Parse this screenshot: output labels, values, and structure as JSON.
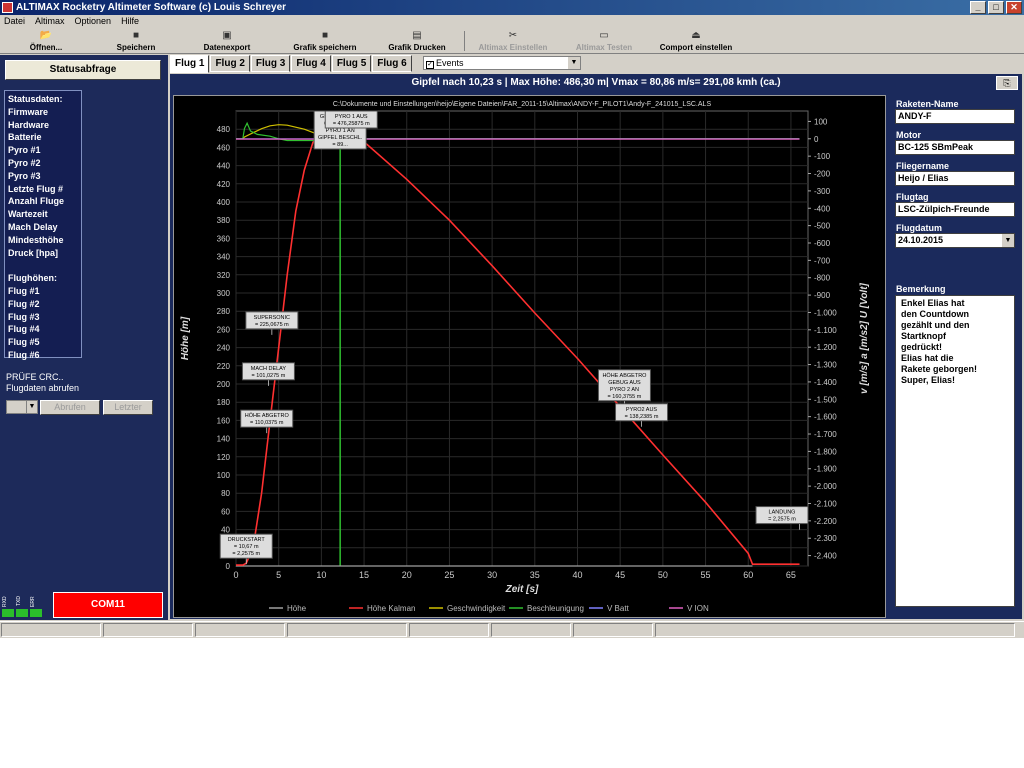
{
  "window": {
    "title": "ALTIMAX Rocketry Altimeter Software     (c) Louis Schreyer"
  },
  "menu": [
    "Datei",
    "Altimax",
    "Optionen",
    "Hilfe"
  ],
  "toolbar": {
    "open": "Öffnen...",
    "save": "Speichern",
    "export": "Datenexport",
    "save_graph": "Grafik speichern",
    "print_graph": "Grafik Drucken",
    "altimax_settings": "Altimax Einstellen",
    "altimax_test": "Altimax Testen",
    "comport": "Comport einstellen"
  },
  "left": {
    "status_button": "Statusabfrage",
    "status_items": [
      "Statusdaten:",
      "Firmware",
      "Hardware",
      "Batterie",
      "Pyro #1",
      "Pyro #2",
      "Pyro #3",
      "Letzte Flug #",
      "Anzahl Fluge",
      "Wartezeit",
      "Mach Delay",
      "Mindesthöhe",
      "Druck [hpa]",
      "",
      "Flughöhen:",
      "Flug #1",
      "Flug #2",
      "Flug #3",
      "Flug #4",
      "Flug #5",
      "Flug #6"
    ],
    "crc": "PRÜFE CRC..",
    "flugdaten": "Flugdaten abrufen",
    "fetch": "Abrufen",
    "last": "Letzter",
    "leds": [
      "RXD",
      "TXD",
      "ERR"
    ],
    "com": "COM11"
  },
  "tabs": [
    "Flug 1",
    "Flug 2",
    "Flug 3",
    "Flug 4",
    "Flug 5",
    "Flug 6"
  ],
  "events_select": "Events",
  "info_bar": "Gipfel nach 10,23 s | Max Höhe: 486,30 m| Vmax = 80,86 m/s= 291,08 kmh (ca.)",
  "chart_data": {
    "type": "line",
    "path_text": "C:\\Dokumente und Einstellungen\\heijo\\Eigene Dateien\\FAR_2011-15\\Altimax\\ANDY-F_PILOT1\\Andy-F_241015_LSC.ALS",
    "xlabel": "Zeit [s]",
    "ylabel": "Höhe [m]",
    "y2label": "v [m/s]  a [m/s2]  U [Volt]",
    "xlim": [
      0,
      67
    ],
    "ylim": [
      0,
      500
    ],
    "y2lim": [
      -2460,
      160
    ],
    "x_ticks": [
      0,
      5,
      10,
      15,
      20,
      25,
      30,
      35,
      40,
      45,
      50,
      55,
      60,
      65
    ],
    "y_ticks": [
      0,
      20,
      40,
      60,
      80,
      100,
      120,
      140,
      160,
      180,
      200,
      220,
      240,
      260,
      280,
      300,
      320,
      340,
      360,
      380,
      400,
      420,
      440,
      460,
      480
    ],
    "y2_ticks": [
      100,
      0,
      -100,
      -200,
      -300,
      -400,
      -500,
      -600,
      -700,
      -800,
      -900,
      -1000,
      -1100,
      -1200,
      -1300,
      -1400,
      -1500,
      -1600,
      -1700,
      -1800,
      -1900,
      -2000,
      -2100,
      -2200,
      -2300,
      -2400
    ],
    "y2_tick_labels": [
      "100",
      "0",
      "-100",
      "-200",
      "-300",
      "-400",
      "-500",
      "-600",
      "-700",
      "-800",
      "-900",
      "-1.000",
      "-1.100",
      "-1.200",
      "-1.300",
      "-1.400",
      "-1.500",
      "-1.600",
      "-1.700",
      "-1.800",
      "-1.900",
      "-2.000",
      "-2.100",
      "-2.200",
      "-2.300",
      "-2.400"
    ],
    "grid": true,
    "legend_position": "bottom",
    "series": [
      {
        "name": "Höhe",
        "color": "#a0a0a0",
        "axis": "left",
        "x": [
          0,
          60.5
        ],
        "y": [
          0,
          0
        ]
      },
      {
        "name": "Höhe Kalman",
        "color": "#ff3030",
        "axis": "left",
        "x": [
          0,
          0.8,
          1.2,
          2,
          3,
          4,
          5,
          6,
          7,
          8,
          9,
          10,
          10.23,
          11,
          12,
          13,
          14,
          15,
          20,
          25,
          30,
          35,
          40,
          45,
          50,
          55,
          60,
          60.5,
          62,
          66
        ],
        "y": [
          1,
          1,
          3,
          20,
          80,
          160,
          240,
          320,
          390,
          435,
          465,
          482,
          486,
          490,
          489,
          482,
          474,
          466,
          425,
          380,
          330,
          278,
          228,
          175,
          122,
          70,
          14,
          2,
          2,
          2
        ]
      },
      {
        "name": "Geschwindigkeit",
        "color": "#d0c000",
        "axis": "right",
        "x": [
          0,
          0.8,
          1,
          2,
          3,
          4,
          5,
          6,
          8,
          10,
          10.23,
          12,
          13,
          14,
          20,
          40,
          60,
          66
        ],
        "y": [
          0,
          0,
          10,
          35,
          58,
          75,
          81,
          78,
          55,
          18,
          15,
          2,
          0,
          0,
          0,
          0,
          0,
          0
        ]
      },
      {
        "name": "Beschleunigung",
        "color": "#30c030",
        "axis": "right",
        "x": [
          0,
          0.8,
          1,
          1.3,
          1.7,
          2.5,
          4,
          5,
          6,
          8,
          10,
          12,
          14,
          20,
          40,
          60,
          66
        ],
        "y": [
          0,
          0,
          60,
          90,
          45,
          25,
          15,
          0,
          -10,
          -10,
          -10,
          -5,
          0,
          0,
          0,
          0,
          0
        ]
      },
      {
        "name": "V Batt",
        "color": "#8080ff",
        "axis": "right",
        "x": [
          0,
          66
        ],
        "y": [
          0,
          0
        ]
      },
      {
        "name": "V ION",
        "color": "#e060c0",
        "axis": "right",
        "x": [
          0,
          66
        ],
        "y": [
          -2,
          -2
        ]
      }
    ],
    "event_lines": [
      {
        "x": 12.2,
        "color": "#30c030"
      }
    ],
    "annotations": [
      {
        "x": 1.2,
        "y": 2,
        "lines": [
          "DRUCKSTART",
          "= 10,67 m",
          "= 2,2575 m"
        ]
      },
      {
        "x": 4.2,
        "y": 254,
        "lines": [
          "SUPERSONIC",
          "= 225,0675 m"
        ]
      },
      {
        "x": 3.8,
        "y": 198,
        "lines": [
          "MACH DELAY",
          "= 101,0275 m"
        ]
      },
      {
        "x": 3.6,
        "y": 146,
        "lines": [
          "HÖHE ABGETRO",
          "= 110,0375 m"
        ]
      },
      {
        "x": 12.2,
        "y": 486,
        "lines": [
          "GIPFEL DRUCK",
          "GEBUG AUS",
          "PYRO 1 AN",
          "GIPFEL BESCHL.",
          "= 89..."
        ]
      },
      {
        "x": 13.5,
        "y": 480,
        "lines": [
          "PYRO 1 AUS",
          "= 476,25875 m"
        ]
      },
      {
        "x": 45.5,
        "y": 175,
        "lines": [
          "HÖHE ABGETRO",
          "GEBUG AUS",
          "PYRO 2 AN",
          "= 160,3755 m"
        ]
      },
      {
        "x": 47.5,
        "y": 153,
        "lines": [
          "PYRO2 AUS",
          "= 138,2385 m"
        ]
      },
      {
        "x": 66,
        "y": 40,
        "lines": [
          "LANDUNG",
          "= 2,2575 m"
        ]
      }
    ]
  },
  "right": {
    "rocket_label": "Raketen-Name",
    "rocket": "ANDY-F",
    "motor_label": "Motor",
    "motor": "BC-125 SBmPeak",
    "pilot_label": "Fliegername",
    "pilot": "Heijo / Elias",
    "site_label": "Flugtag",
    "site": "LSC-Zülpich-Freunde",
    "date_label": "Flugdatum",
    "date": "24.10.2015",
    "remark_label": "Bemerkung",
    "remark_lines": [
      "Enkel Elias hat",
      "den Countdown",
      "gezählt und den",
      "Startknopf",
      "gedrückt!",
      "Elias hat die",
      "Rakete geborgen!",
      "Super, Elias!"
    ]
  },
  "colors": {
    "panel": "#1b2a5c",
    "com_alarm": "#ff0000",
    "titlebar": "#0a246a"
  }
}
